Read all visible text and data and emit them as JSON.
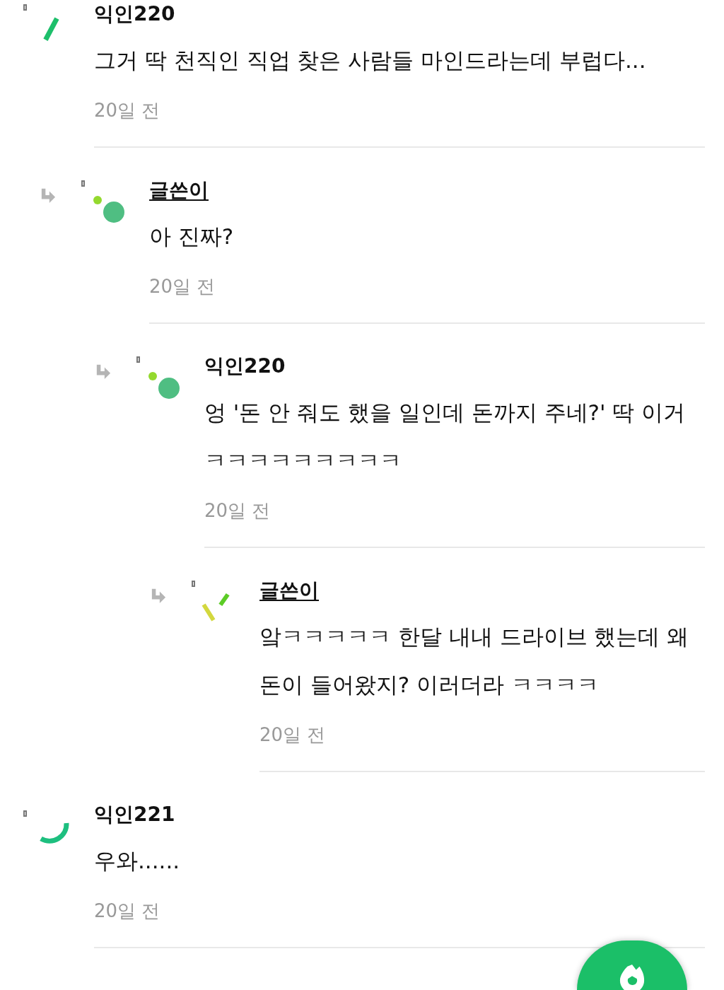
{
  "comments": [
    {
      "author": "익인220",
      "is_writer": false,
      "avatar": {
        "kind": "bar"
      },
      "text": "그거 딱 천직인 직업 찾은 사람들 마인드라는데 부럽다...",
      "time": "20일 전",
      "children": [
        {
          "author": "글쓴이",
          "is_writer": true,
          "avatar": {
            "kind": "dots"
          },
          "text": "아 진짜?",
          "time": "20일 전",
          "children": [
            {
              "author": "익인220",
              "is_writer": false,
              "avatar": {
                "kind": "dots"
              },
              "text": "엉 '돈 안 줘도 했을 일인데 돈까지 주네?' 딱 이거ㅋㅋㅋㅋㅋㅋㅋㅋㅋ",
              "time": "20일 전",
              "children": [
                {
                  "author": "글쓴이",
                  "is_writer": true,
                  "avatar": {
                    "kind": "slashes"
                  },
                  "text": "앜ㅋㅋㅋㅋㅋ 한달 내내 드라이브 했는데 왜 돈이 들어왔지? 이러더라 ㅋㅋㅋㅋ",
                  "time": "20일 전"
                }
              ]
            }
          ]
        }
      ]
    },
    {
      "author": "익인221",
      "is_writer": false,
      "avatar": {
        "kind": "arc"
      },
      "text": "우와......",
      "time": "20일 전"
    }
  ]
}
